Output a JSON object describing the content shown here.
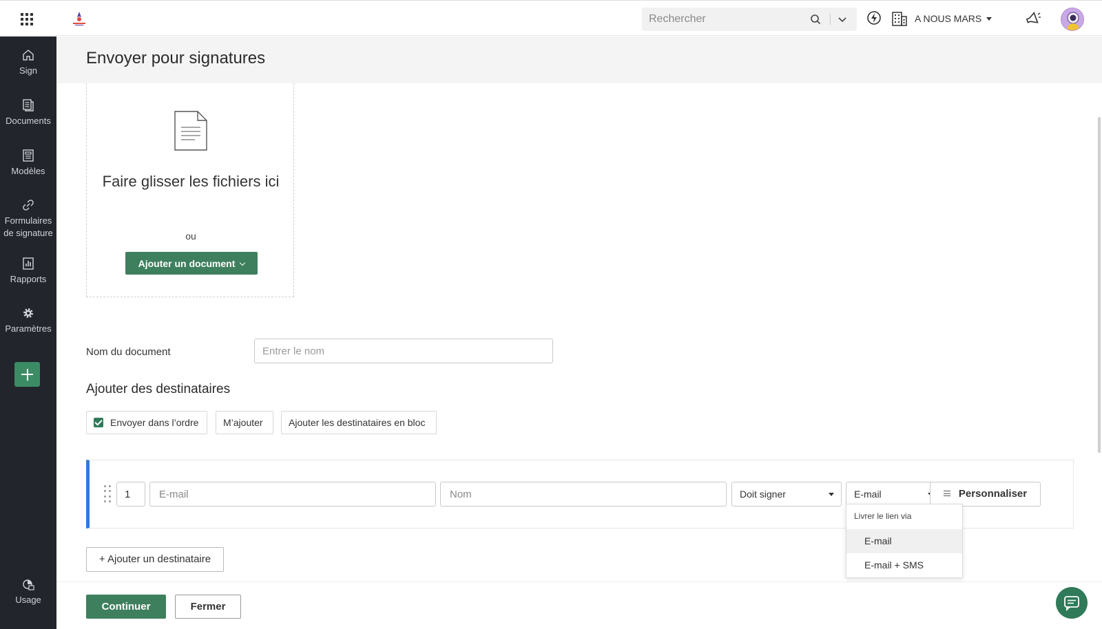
{
  "topbar": {
    "search_placeholder": "Rechercher",
    "org_name": "A NOUS MARS"
  },
  "sidebar": {
    "items": [
      {
        "label": "Sign",
        "icon": "home-icon"
      },
      {
        "label": "Documents",
        "icon": "documents-icon"
      },
      {
        "label": "Modèles",
        "icon": "templates-icon"
      },
      {
        "label": "Formulaires de signature",
        "icon": "link-icon"
      },
      {
        "label": "Rapports",
        "icon": "reports-icon"
      },
      {
        "label": "Paramètres",
        "icon": "gear-icon"
      }
    ],
    "usage_label": "Usage"
  },
  "page": {
    "title": "Envoyer pour signatures"
  },
  "dropzone": {
    "text": "Faire glisser les fichiers ici",
    "or_text": "ou",
    "add_button": "Ajouter un document"
  },
  "document_name": {
    "label": "Nom du document",
    "placeholder": "Entrer le nom",
    "value": ""
  },
  "recipients": {
    "title": "Ajouter des destinataires",
    "send_in_order": {
      "label": "Envoyer dans l’ordre",
      "checked": true
    },
    "add_me": "M’ajouter",
    "bulk_add": "Ajouter les destinataires en bloc",
    "rows": [
      {
        "order": "1",
        "email_placeholder": "E-mail",
        "name_placeholder": "Nom",
        "role": "Doit signer",
        "delivery": "E-mail",
        "customize": "Personnaliser"
      }
    ],
    "add_recipient": "+ Ajouter un destinataire"
  },
  "delivery_dropdown": {
    "header": "Livrer le lien via",
    "options": [
      "E-mail",
      "E-mail + SMS"
    ],
    "selected_index": 0
  },
  "footer": {
    "continue": "Continuer",
    "close": "Fermer"
  },
  "colors": {
    "primary_green": "#3e7f5d",
    "sidebar_bg": "#22252b",
    "accent_blue": "#2f7bd6"
  }
}
